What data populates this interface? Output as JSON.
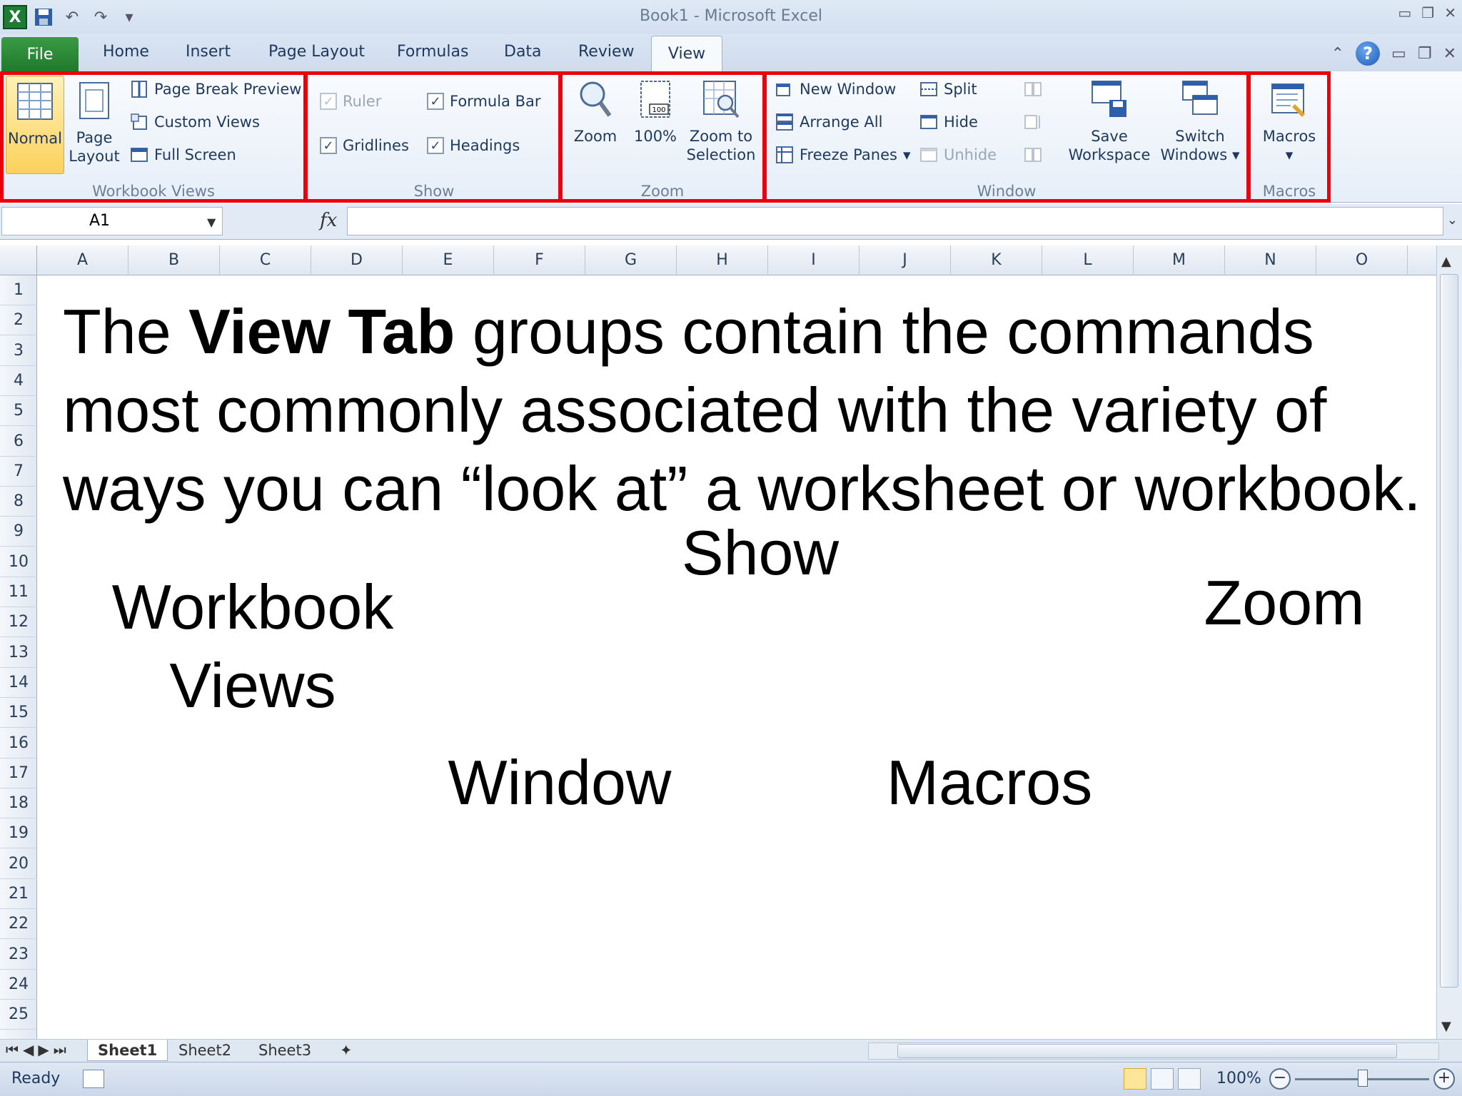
{
  "window": {
    "title": "Book1  -  Microsoft Excel",
    "logo": "X"
  },
  "tabs": {
    "file": "File",
    "home": "Home",
    "insert": "Insert",
    "page_layout": "Page Layout",
    "formulas": "Formulas",
    "data": "Data",
    "review": "Review",
    "view": "View"
  },
  "ribbon": {
    "workbook_views": {
      "label": "Workbook Views",
      "normal": "Normal",
      "page_layout_l1": "Page",
      "page_layout_l2": "Layout",
      "page_break_preview": "Page Break Preview",
      "custom_views": "Custom Views",
      "full_screen": "Full Screen"
    },
    "show": {
      "label": "Show",
      "ruler": "Ruler",
      "formula_bar": "Formula Bar",
      "gridlines": "Gridlines",
      "headings": "Headings"
    },
    "zoom": {
      "label": "Zoom",
      "zoom": "Zoom",
      "hundred": "100%",
      "zoom_to_l1": "Zoom to",
      "zoom_to_l2": "Selection"
    },
    "window": {
      "label": "Window",
      "new_window": "New Window",
      "arrange_all": "Arrange All",
      "freeze_panes": "Freeze Panes",
      "split": "Split",
      "hide": "Hide",
      "unhide": "Unhide",
      "save_l1": "Save",
      "save_l2": "Workspace",
      "switch_l1": "Switch",
      "switch_l2": "Windows"
    },
    "macros": {
      "label": "Macros",
      "macros": "Macros"
    }
  },
  "formula_bar": {
    "name_box": "A1",
    "fx": "fx"
  },
  "columns": [
    "A",
    "B",
    "C",
    "D",
    "E",
    "F",
    "G",
    "H",
    "I",
    "J",
    "K",
    "L",
    "M",
    "N",
    "O"
  ],
  "rows": [
    "1",
    "2",
    "3",
    "4",
    "5",
    "6",
    "7",
    "8",
    "9",
    "10",
    "11",
    "12",
    "13",
    "14",
    "15",
    "16",
    "17",
    "18",
    "19",
    "20",
    "21",
    "22",
    "23",
    "24",
    "25"
  ],
  "overlay": {
    "para_pre": "The ",
    "para_bold": "View Tab",
    "para_post": " groups contain the commands most commonly associated with the variety of ways you can “look at” a worksheet or workbook.",
    "label_workbook_l1": "Workbook",
    "label_workbook_l2": "Views",
    "label_show": "Show",
    "label_zoom": "Zoom",
    "label_window": "Window",
    "label_macros": "Macros"
  },
  "sheets": [
    "Sheet1",
    "Sheet2",
    "Sheet3"
  ],
  "status": {
    "ready": "Ready",
    "zoom": "100%"
  },
  "colors": {
    "highlight_box": "#e8000b",
    "file_tab": "#1f7a2c",
    "active_view_button": "#fde59a"
  }
}
